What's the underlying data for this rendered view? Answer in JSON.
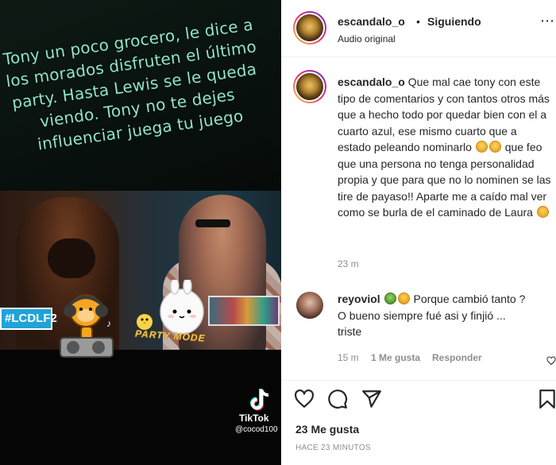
{
  "media": {
    "caption": "Tony un poco grocero, le dice a los morados disfruten el último party. Hasta Lewis se le queda viendo. Tony no te dejes influenciar juega tu juego",
    "hashtag": "#LCDLF2",
    "sticker_text": "PARTY MODE",
    "tiktok_brand": "TikTok",
    "tiktok_user": "@cocod100"
  },
  "header": {
    "username": "escandalo_o",
    "separator": "•",
    "follow_status": "Siguiendo",
    "audio": "Audio original",
    "more": "⋯"
  },
  "comments": [
    {
      "username": "escandalo_o",
      "text_1": "Que mal cae tony con este tipo de comentarios y con tantos otros más que a hecho todo por quedar bien con el a cuarto azul, ese mismo cuarto que a estado peleando nominarlo",
      "text_2": "que feo que una persona no tenga personalidad propia y que para que no lo nominen se las tire de payaso!! Aparte me a caído mal ver como se burla de el caminado de Laura",
      "time": "23 m",
      "emojis": [
        "facepalm",
        "facepalm",
        "facepalm"
      ]
    },
    {
      "username": "reyoviol",
      "text": "Porque cambió tanto ? O bueno siempre fué asi y finjió ... triste",
      "time": "15 m",
      "likes": "1 Me gusta",
      "reply": "Responder",
      "emojis": [
        "sick",
        "crying"
      ]
    }
  ],
  "actions": {
    "icons": [
      "heart-icon",
      "comment-icon",
      "share-icon",
      "save-icon"
    ],
    "likes": "23 Me gusta",
    "posted": "HACE 23 MINUTOS"
  }
}
